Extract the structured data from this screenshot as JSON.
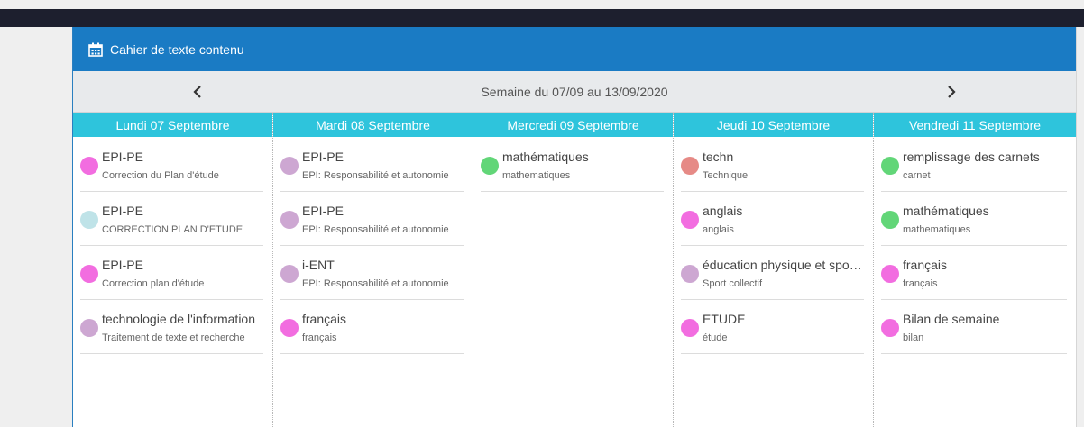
{
  "panel": {
    "title": "Cahier de texte contenu",
    "week_label": "Semaine du 07/09 au 13/09/2020",
    "prev_icon": "chevron-left-icon",
    "next_icon": "chevron-right-icon"
  },
  "colors": {
    "header": "#1a7bc4",
    "day_header": "#2ec4dc",
    "pink": "#f26de0",
    "mauve": "#cda7d2",
    "lightblue": "#bfe3e8",
    "green": "#62d678",
    "salmon": "#e68a86"
  },
  "days": [
    {
      "label": "Lundi 07 Septembre",
      "entries": [
        {
          "subject": "EPI-PE",
          "desc": "Correction du Plan d'étude",
          "color": "#f26de0"
        },
        {
          "subject": "EPI-PE",
          "desc": "CORRECTION PLAN D'ETUDE",
          "color": "#bfe3e8"
        },
        {
          "subject": "EPI-PE",
          "desc": "Correction plan d'étude",
          "color": "#f26de0"
        },
        {
          "subject": "technologie de l'information",
          "desc": "Traitement de texte et recherche",
          "color": "#cda7d2"
        }
      ]
    },
    {
      "label": "Mardi 08 Septembre",
      "entries": [
        {
          "subject": "EPI-PE",
          "desc": "EPI: Responsabilité et autonomie",
          "color": "#cda7d2"
        },
        {
          "subject": "EPI-PE",
          "desc": "EPI: Responsabilité et autonomie",
          "color": "#cda7d2"
        },
        {
          "subject": "i-ENT",
          "desc": "EPI: Responsabilité et autonomie",
          "color": "#cda7d2"
        },
        {
          "subject": "français",
          "desc": "français",
          "color": "#f26de0"
        }
      ]
    },
    {
      "label": "Mercredi 09 Septembre",
      "entries": [
        {
          "subject": "mathématiques",
          "desc": "mathematiques",
          "color": "#62d678"
        }
      ]
    },
    {
      "label": "Jeudi 10 Septembre",
      "entries": [
        {
          "subject": "techn",
          "desc": "Technique",
          "color": "#e68a86"
        },
        {
          "subject": "anglais",
          "desc": "anglais",
          "color": "#f26de0"
        },
        {
          "subject": "éducation physique et sportive",
          "desc": "Sport collectif",
          "color": "#cda7d2"
        },
        {
          "subject": "ETUDE",
          "desc": "étude",
          "color": "#f26de0"
        }
      ]
    },
    {
      "label": "Vendredi 11 Septembre",
      "entries": [
        {
          "subject": "remplissage des carnets",
          "desc": "carnet",
          "color": "#62d678"
        },
        {
          "subject": "mathématiques",
          "desc": "mathematiques",
          "color": "#62d678"
        },
        {
          "subject": "français",
          "desc": "français",
          "color": "#f26de0"
        },
        {
          "subject": "Bilan de semaine",
          "desc": "bilan",
          "color": "#f26de0"
        }
      ]
    }
  ]
}
